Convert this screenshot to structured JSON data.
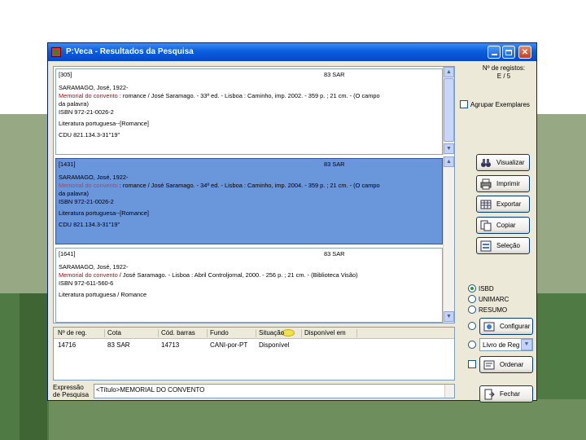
{
  "window": {
    "title": "P:Veca - Resultados da Pesquisa"
  },
  "right_panel": {
    "registos_label": "Nº de registos:",
    "registos_value": "E / 5",
    "agrupar_label": "Agrupar Exemplares",
    "buttons": {
      "visualizar": "Visualizar",
      "imprimir": "Imprimir",
      "exportar": "Exportar",
      "copiar": "Copiar",
      "selecao": "Seleção"
    },
    "formats": {
      "isbd": "ISBD",
      "unimarc": "UNIMARC",
      "resumo": "RESUMO"
    },
    "format_selected": "ISBD",
    "configurar": "Configurar",
    "combo_value": "Livro de Reg",
    "ordenar": "Ordenar",
    "fechar": "Fechar"
  },
  "records": [
    {
      "id": "[305]",
      "cota": "83 SAR",
      "author": "SARAMAGO, José, 1922-",
      "title": "Memorial do convento",
      "desc": " : romance / José Saramago. - 33ª ed. - Lisboa : Caminho, imp. 2002. - 359 p. ; 21 cm. - (O campo",
      "desc_2": "da palavra)",
      "isbn": "ISBN 972-21-0026-2",
      "subject": "Literatura portuguesa--[Romance]",
      "cdu": "CDU 821.134.3-31\"19\"",
      "selected": false
    },
    {
      "id": "[1431]",
      "cota": "83 SAR",
      "author": "SARAMAGO, José, 1922-",
      "title": "Memorial do convento",
      "desc": " : romance / José Saramago. - 34ª ed. - Lisboa : Caminho, imp. 2004. - 359 p. ; 21 cm. - (O campo",
      "desc_2": "da palavra)",
      "isbn": "ISBN 972-21-0026-2",
      "subject": "Literatura portuguesa--[Romance]",
      "cdu": "CDU 821.134.3-31\"19\"",
      "selected": true
    },
    {
      "id": "[1641]",
      "cota": "83 SAR",
      "author": "SARAMAGO, José, 1922-",
      "title": "Memorial do convento",
      "desc": " / José Saramago. - Lisboa : Abril Controljornal, 2000. - 256 p. ; 21 cm. - (Biblioteca Visão)",
      "desc_2": "",
      "isbn": "ISBN 972-611-560-6",
      "subject": "Literatura portuguesa / Romance",
      "cdu": "",
      "selected": false
    }
  ],
  "exemplares": {
    "headers": [
      "Nº de reg.",
      "Cota",
      "Cód. barras",
      "Fundo",
      "Situação",
      "Disponível em"
    ],
    "row": [
      "14716",
      "83 SAR",
      "14713",
      "CANI-por-PT",
      "Disponível",
      ""
    ]
  },
  "expression": {
    "label": "Expressão de Pesquisa",
    "value": "<Título>MEMORIAL DO CONVENTO"
  }
}
